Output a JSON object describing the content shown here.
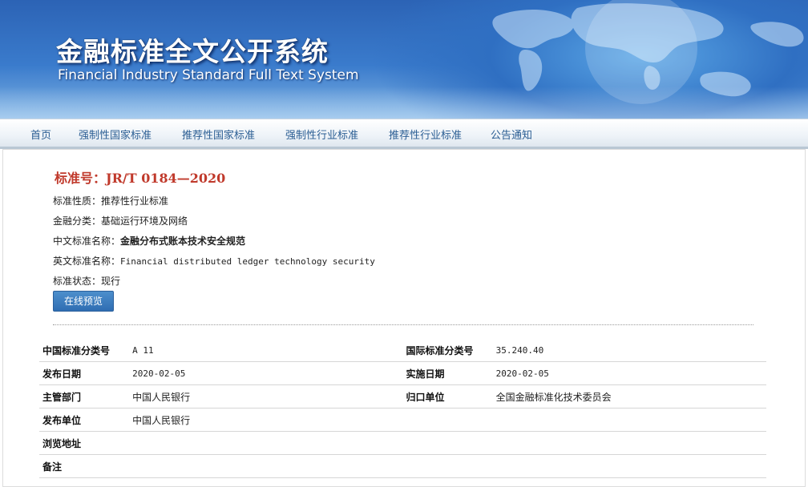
{
  "banner": {
    "title_cn": "金融标准全文公开系统",
    "title_en": "Financial Industry Standard Full Text System"
  },
  "nav": {
    "items": [
      "首页",
      "强制性国家标准",
      "推荐性国家标准",
      "强制性行业标准",
      "推荐性行业标准",
      "公告通知"
    ]
  },
  "standard": {
    "number_label": "标准号：",
    "number": "JR/T 0184—2020",
    "nature_label": "标准性质：",
    "nature": "推荐性行业标准",
    "category_label": "金融分类：",
    "category": "基础运行环境及网络",
    "cn_name_label": "中文标准名称：",
    "cn_name": "金融分布式账本技术安全规范",
    "en_name_label": "英文标准名称：",
    "en_name": "Financial distributed ledger technology security",
    "status_label": "标准状态：",
    "status": "现行",
    "preview_button": "在线预览"
  },
  "meta": {
    "ccs_label": "中国标准分类号",
    "ccs": "A 11",
    "ics_label": "国际标准分类号",
    "ics": "35.240.40",
    "publish_date_label": "发布日期",
    "publish_date": "2020-02-05",
    "effective_date_label": "实施日期",
    "effective_date": "2020-02-05",
    "authority_label": "主管部门",
    "authority": "中国人民银行",
    "responsible_label": "归口单位",
    "responsible": "全国金融标准化技术委员会",
    "publisher_label": "发布单位",
    "publisher": "中国人民银行",
    "browse_label": "浏览地址",
    "browse": "",
    "remark_label": "备注",
    "remark": ""
  },
  "colors": {
    "banner_blue": "#2c63b5",
    "nav_link": "#2a5d93",
    "std_number": "#c0392b",
    "button": "#3a7cc0"
  }
}
